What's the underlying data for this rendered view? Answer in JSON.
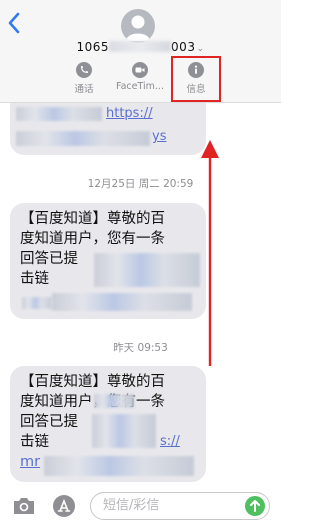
{
  "header": {
    "contact_prefix": "1065",
    "contact_suffix": "003",
    "contact_chevron": "⌄",
    "actions": [
      {
        "label": "通话",
        "icon": "phone-icon"
      },
      {
        "label": "FaceTim...",
        "icon": "video-icon"
      },
      {
        "label": "信息",
        "icon": "info-icon"
      }
    ]
  },
  "messages": [
    {
      "time": "",
      "lines": [
        "",
        "",
        ""
      ]
    },
    {
      "time": "12月25日 周二 20:59",
      "lines": [
        "【百度知道】尊敬的百",
        "度知道用户，您有一条",
        "回答已提",
        "击链",
        ""
      ]
    },
    {
      "time": "昨天 09:53",
      "lines": [
        "【百度知道】尊敬的百",
        "度知道用户，您有一条",
        "回答已提",
        "击链",
        "mr"
      ]
    }
  ],
  "partial_link_1": "https://",
  "partial_link_2": "ys",
  "partial_link_3": "s://",
  "composer": {
    "placeholder": "短信/彩信"
  },
  "colors": {
    "highlight": "#e02424",
    "bubble": "#e8e8ec",
    "link": "#5a6fd0",
    "send": "#4fbf5f"
  }
}
